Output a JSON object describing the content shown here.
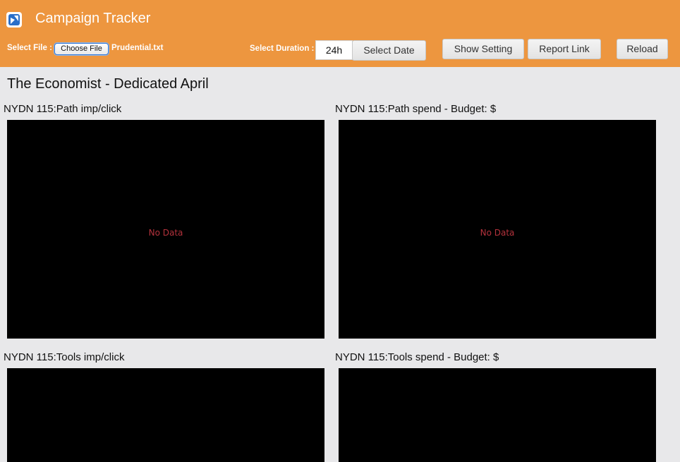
{
  "header": {
    "app_title": "Campaign Tracker",
    "logo_icon": "campaign-tracker-logo-icon",
    "select_file_label": "Select File :",
    "choose_file_label": "Choose File",
    "file_name": "Prudential.txt",
    "select_duration_label": "Select Duration :",
    "duration_value": "24h",
    "select_date_label": "Select Date",
    "show_setting_label": "Show Setting",
    "report_link_label": "Report Link",
    "reload_label": "Reload",
    "accent_color": "#ed963f"
  },
  "main": {
    "page_title": "The Economist - Dedicated April",
    "charts": [
      {
        "title": "NYDN 115:Path imp/click",
        "status": "No Data"
      },
      {
        "title": "NYDN 115:Path spend - Budget: $",
        "status": "No Data"
      },
      {
        "title": "NYDN 115:Tools imp/click",
        "status": ""
      },
      {
        "title": "NYDN 115:Tools spend - Budget: $",
        "status": ""
      }
    ]
  }
}
